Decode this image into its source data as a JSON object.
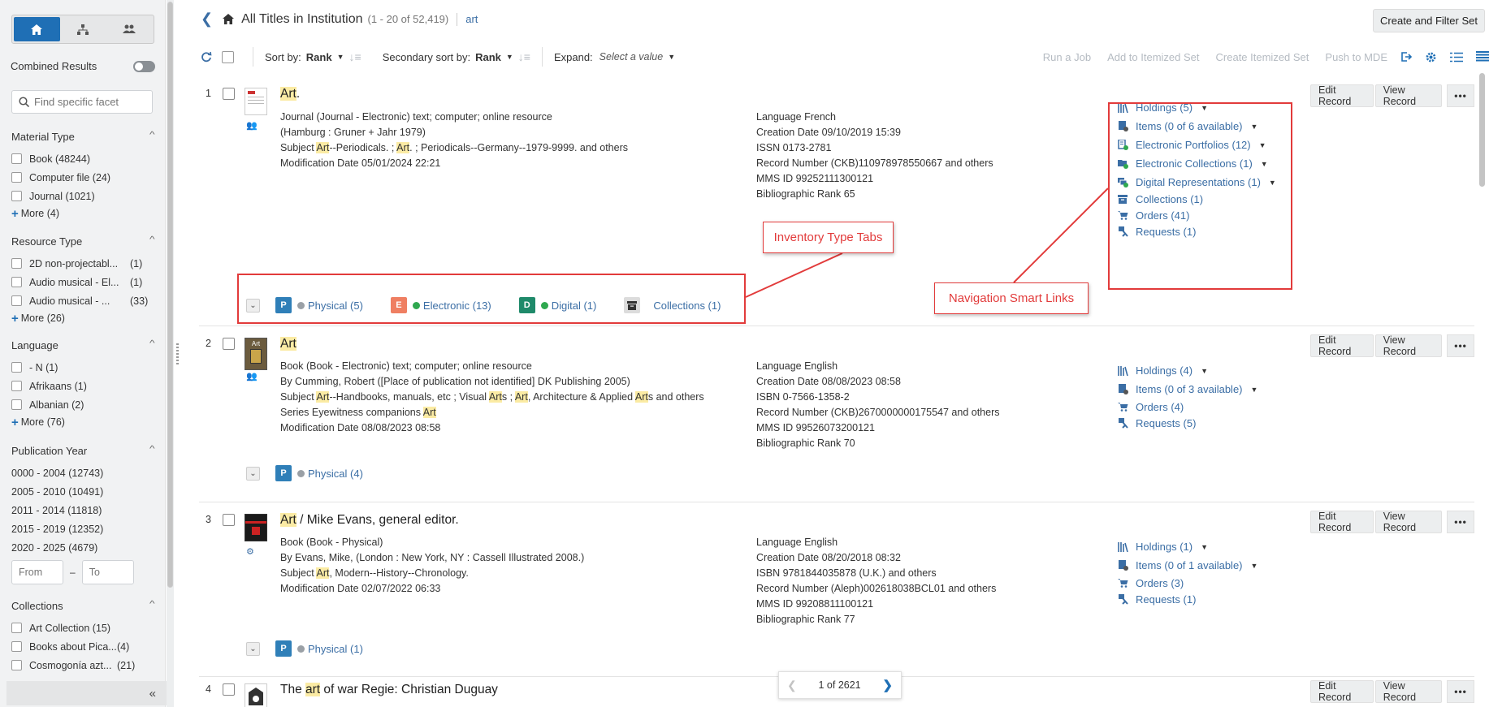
{
  "sidebar": {
    "combined_label": "Combined Results",
    "facet_search_placeholder": "Find specific facet",
    "material_type": {
      "title": "Material Type",
      "items": [
        {
          "label": "Book (48244)"
        },
        {
          "label": "Computer file (24)"
        },
        {
          "label": "Journal (1021)"
        }
      ],
      "more": "More (4)"
    },
    "resource_type": {
      "title": "Resource Type",
      "items": [
        {
          "label": "2D non-projectabl...",
          "count": "(1)"
        },
        {
          "label": "Audio musical - El...",
          "count": "(1)"
        },
        {
          "label": "Audio musical - ...",
          "count": "(33)"
        }
      ],
      "more": "More (26)"
    },
    "language": {
      "title": "Language",
      "items": [
        {
          "label": "- N (1)"
        },
        {
          "label": "Afrikaans (1)"
        },
        {
          "label": "Albanian (2)"
        }
      ],
      "more": "More (76)"
    },
    "publication_year": {
      "title": "Publication Year",
      "items": [
        "0000 - 2004 (12743)",
        "2005 - 2010 (10491)",
        "2011 - 2014 (11818)",
        "2015 - 2019 (12352)",
        "2020 - 2025 (4679)"
      ],
      "from_placeholder": "From",
      "dash": "–",
      "to_placeholder": "To"
    },
    "collections": {
      "title": "Collections",
      "items": [
        {
          "label": "Art Collection (15)"
        },
        {
          "label": "Books about Pica...",
          "count": "(4)"
        },
        {
          "label": "Cosmogonía azt...",
          "count": "(21)"
        }
      ]
    }
  },
  "header": {
    "title": "All Titles in Institution",
    "range": "(1 - 20 of 52,419)",
    "query": "art",
    "create_filter_set": "Create and Filter Set"
  },
  "toolbar": {
    "sort_by_label": "Sort by:",
    "sort_by_value": "Rank",
    "secondary_label": "Secondary sort by:",
    "secondary_value": "Rank",
    "expand_label": "Expand:",
    "expand_value": "Select a value",
    "actions": [
      "Run a Job",
      "Add to Itemized Set",
      "Create Itemized Set",
      "Push to MDE"
    ]
  },
  "record_buttons": {
    "edit": "Edit Record",
    "view": "View Record",
    "more": "•••"
  },
  "results": [
    {
      "num": "1",
      "title_hl": "Art",
      "title_rest": ".",
      "left_lines": [
        "Journal (Journal - Electronic) text; computer; online resource",
        "(Hamburg : Gruner + Jahr 1979)",
        "Subject Art--Periodicals. ; Art. ; Periodicals--Germany--1979-9999. and others",
        "Modification Date 05/01/2024 22:21"
      ],
      "mid_lines": [
        "Language French",
        "Creation Date 09/10/2019 15:39",
        "ISSN 0173-2781",
        "Record Number (CKB)110978978550667 and others",
        "MMS ID 99252111300121",
        "Bibliographic Rank 65"
      ],
      "links": [
        {
          "label": "Holdings (5)",
          "icon": "holdings-icon",
          "caret": true
        },
        {
          "label": "Items (0 of 6 available)",
          "icon": "items-icon",
          "caret": true
        },
        {
          "label": "Electronic Portfolios (12)",
          "icon": "portfolio-icon",
          "caret": true
        },
        {
          "label": "Electronic Collections (1)",
          "icon": "electronic-collection-icon",
          "caret": true
        },
        {
          "label": "Digital Representations (1)",
          "icon": "digital-representation-icon",
          "caret": true
        },
        {
          "label": "Collections (1)",
          "icon": "collection-icon",
          "caret": false
        },
        {
          "label": "Orders (41)",
          "icon": "cart-icon",
          "caret": false
        },
        {
          "label": "Requests (1)",
          "icon": "request-icon",
          "caret": false
        }
      ],
      "tabs": [
        {
          "badge": "P",
          "label": "Physical (5)",
          "badge_color": "#2f7fb8",
          "dot_color": "#9aa0a6"
        },
        {
          "badge": "E",
          "label": "Electronic (13)",
          "badge_color": "#ef7f62",
          "dot_color": "#2fa84f"
        },
        {
          "badge": "D",
          "label": "Digital (1)",
          "badge_color": "#1f8a6a",
          "dot_color": "#2fa84f"
        },
        {
          "badge": "archive",
          "label": "Collections (1)",
          "badge_color": "#dcdcdc",
          "dot_color": ""
        }
      ]
    },
    {
      "num": "2",
      "title_hl": "Art",
      "title_rest": "",
      "left_lines": [
        "Book (Book - Electronic) text; computer; online resource",
        "By Cumming, Robert ([Place of publication not identified] DK Publishing 2005)",
        "Subject Art--Handbooks, manuals, etc ; Visual Arts ; Art, Architecture & Applied Arts and others",
        "Series Eyewitness companions Art",
        "Modification Date 08/08/2023 08:58"
      ],
      "mid_lines": [
        "Language English",
        "Creation Date 08/08/2023 08:58",
        "ISBN 0-7566-1358-2",
        "Record Number (CKB)2670000000175547 and others",
        "MMS ID 99526073200121",
        "Bibliographic Rank 70"
      ],
      "links": [
        {
          "label": "Holdings (4)",
          "icon": "holdings-icon",
          "caret": true
        },
        {
          "label": "Items (0 of 3 available)",
          "icon": "items-icon",
          "caret": true
        },
        {
          "label": "Orders (4)",
          "icon": "cart-icon",
          "caret": false
        },
        {
          "label": "Requests (5)",
          "icon": "request-icon",
          "caret": false
        }
      ],
      "tabs": [
        {
          "badge": "P",
          "label": "Physical (4)",
          "badge_color": "#2f7fb8",
          "dot_color": "#9aa0a6"
        }
      ]
    },
    {
      "num": "3",
      "title_hl": "Art",
      "title_rest": " / Mike Evans, general editor.",
      "left_lines": [
        "Book (Book - Physical)",
        "By Evans, Mike, (London : New York, NY : Cassell Illustrated 2008.)",
        "Subject Art, Modern--History--Chronology.",
        "Modification Date 02/07/2022 06:33"
      ],
      "mid_lines": [
        "Language English",
        "Creation Date 08/20/2018 08:32",
        "ISBN 9781844035878 (U.K.) and others",
        "Record Number (Aleph)002618038BCL01 and others",
        "MMS ID 99208811100121",
        "Bibliographic Rank 77"
      ],
      "links": [
        {
          "label": "Holdings (1)",
          "icon": "holdings-icon",
          "caret": true
        },
        {
          "label": "Items (0 of 1 available)",
          "icon": "items-icon",
          "caret": true
        },
        {
          "label": "Orders (3)",
          "icon": "cart-icon",
          "caret": false
        },
        {
          "label": "Requests (1)",
          "icon": "request-icon",
          "caret": false
        }
      ],
      "tabs": [
        {
          "badge": "P",
          "label": "Physical (1)",
          "badge_color": "#2f7fb8",
          "dot_color": "#9aa0a6"
        }
      ]
    },
    {
      "num": "4",
      "title_pre": "The ",
      "title_hl": "art",
      "title_rest": " of war Regie: Christian Duguay"
    }
  ],
  "annotations": {
    "inventory_tabs": "Inventory Type Tabs",
    "smart_links": "Navigation Smart Links"
  },
  "pager": {
    "label": "1 of 2621"
  }
}
